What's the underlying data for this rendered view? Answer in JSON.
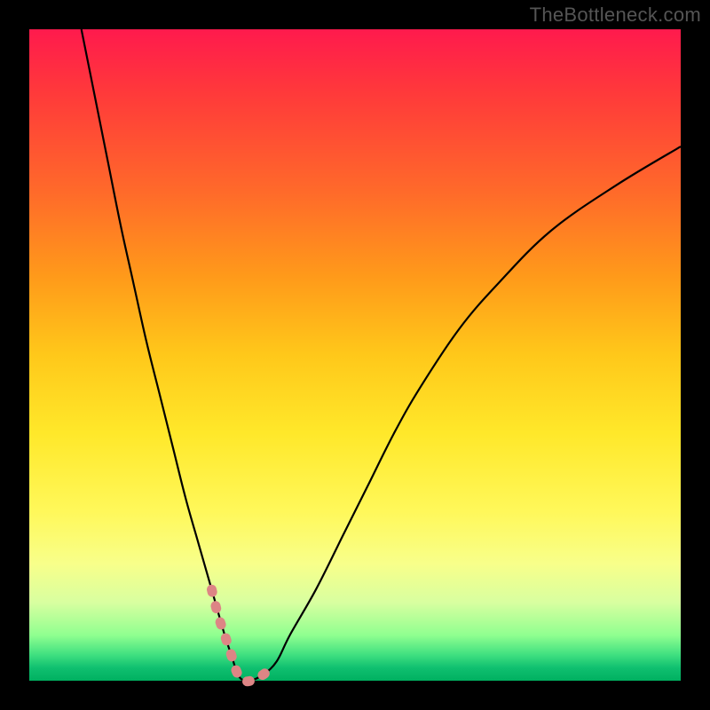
{
  "watermark": "TheBottleneck.com",
  "chart_data": {
    "type": "line",
    "title": "",
    "xlabel": "",
    "ylabel": "",
    "xlim": [
      0,
      100
    ],
    "ylim": [
      0,
      100
    ],
    "grid": false,
    "legend": false,
    "gradient_colors": [
      "#ff1a4d",
      "#ff6a2a",
      "#ffc81a",
      "#fff85a",
      "#90ff90",
      "#00b060"
    ],
    "series": [
      {
        "name": "curve",
        "color": "#000000",
        "x": [
          8,
          10,
          12,
          14,
          16,
          18,
          20,
          22,
          24,
          26,
          28,
          30,
          31,
          32,
          33,
          34,
          36,
          38,
          40,
          44,
          48,
          52,
          56,
          60,
          66,
          72,
          80,
          90,
          100
        ],
        "y": [
          100,
          90,
          80,
          70,
          61,
          52,
          44,
          36,
          28,
          21,
          14,
          7,
          4,
          1,
          0,
          0,
          1,
          3,
          7,
          14,
          22,
          30,
          38,
          45,
          54,
          61,
          69,
          76,
          82
        ]
      },
      {
        "name": "highlight-segment",
        "color": "#e08080",
        "style": "dashed-thick",
        "x": [
          28,
          29,
          30,
          31,
          32,
          33,
          34,
          35,
          36,
          37
        ],
        "y": [
          14,
          10,
          7,
          4,
          1,
          0,
          0,
          0.5,
          1,
          2
        ]
      }
    ]
  }
}
